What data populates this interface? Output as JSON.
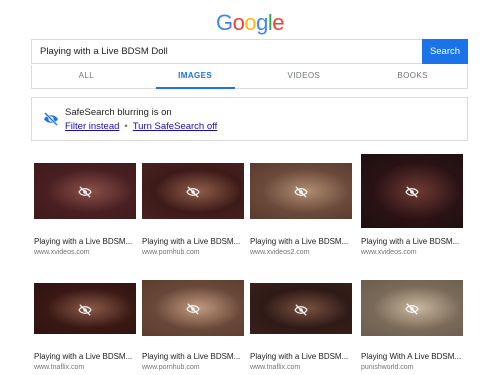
{
  "logo": {
    "letters": [
      "G",
      "o",
      "o",
      "g",
      "l",
      "e"
    ],
    "colors": [
      "#4285f4",
      "#ea4335",
      "#fbbc05",
      "#4285f4",
      "#34a853",
      "#ea4335"
    ]
  },
  "search": {
    "value": "Playing with a Live BDSM Doll",
    "button_label": "Search"
  },
  "tabs": [
    {
      "label": "ALL"
    },
    {
      "label": "IMAGES",
      "active": true
    },
    {
      "label": "VIDEOS"
    },
    {
      "label": "BOOKS"
    }
  ],
  "safesearch": {
    "title": "SafeSearch blurring is on",
    "filter_link": "Filter instead",
    "separator": "•",
    "turn_off_link": "Turn SafeSearch off",
    "icon": "eye-crossed-icon"
  },
  "results": [
    {
      "title": "Playing with a Live BDSM...",
      "domain": "www.xvideos.com",
      "colors": [
        "#4a1f22",
        "#8a5048",
        "#3d1b1e"
      ]
    },
    {
      "title": "Playing with a Live BDSM...",
      "domain": "www.pornhub.com",
      "colors": [
        "#3d1a18",
        "#8e5d4a",
        "#4a2220"
      ]
    },
    {
      "title": "Playing with a Live BDSM...",
      "domain": "www.xvideos2.com",
      "colors": [
        "#6b4a3a",
        "#b28d73",
        "#5a3a2e"
      ]
    },
    {
      "title": "Playing with a Live BDSM...",
      "domain": "www.xvideos.com",
      "colors": [
        "#2a1214",
        "#6e3a34",
        "#1e0e10"
      ]
    },
    {
      "title": "Playing with a Live BDSM...",
      "domain": "www.tnaflix.com",
      "colors": [
        "#3a1814",
        "#8a5a48",
        "#2e1410"
      ]
    },
    {
      "title": "Playing with a Live BDSM...",
      "domain": "www.pornhub.com",
      "colors": [
        "#6a4838",
        "#c29a82",
        "#5a3c2e"
      ]
    },
    {
      "title": "Playing with a Live BDSM...",
      "domain": "www.tnaflix.com",
      "colors": [
        "#2e1a16",
        "#7a5040",
        "#3a2018"
      ]
    },
    {
      "title": "Playing With A Live BDSM...",
      "domain": "punishworld.com",
      "colors": [
        "#7a6a58",
        "#c8b8a0",
        "#6a5e50"
      ]
    }
  ]
}
